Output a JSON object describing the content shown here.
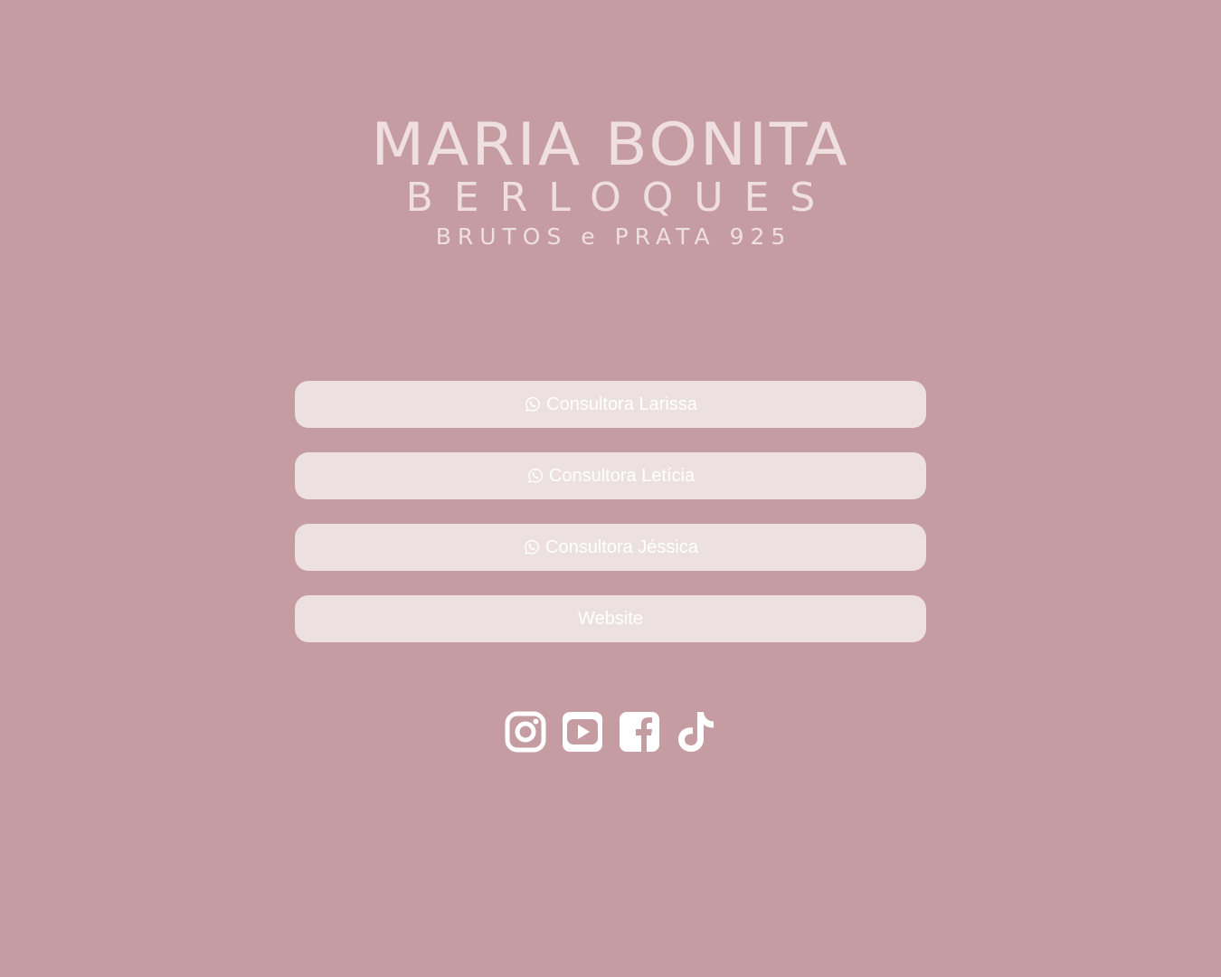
{
  "logo": {
    "line1": "MARIA BONITA",
    "line2": "BERLOQUES",
    "line3": "BRUTOS e PRATA 925"
  },
  "links": [
    {
      "label": "Consultora Larissa",
      "icon": "whatsapp-icon"
    },
    {
      "label": "Consultora Letícia",
      "icon": "whatsapp-icon"
    },
    {
      "label": "Consultora Jéssica",
      "icon": "whatsapp-icon"
    },
    {
      "label": "Website",
      "icon": ""
    }
  ],
  "socials": [
    "instagram-icon",
    "youtube-icon",
    "facebook-icon",
    "tiktok-icon"
  ],
  "colors": {
    "background": "#c69ca3",
    "button": "#ece0e1",
    "logo_text": "#efdfe1",
    "button_text": "#ffffff"
  }
}
